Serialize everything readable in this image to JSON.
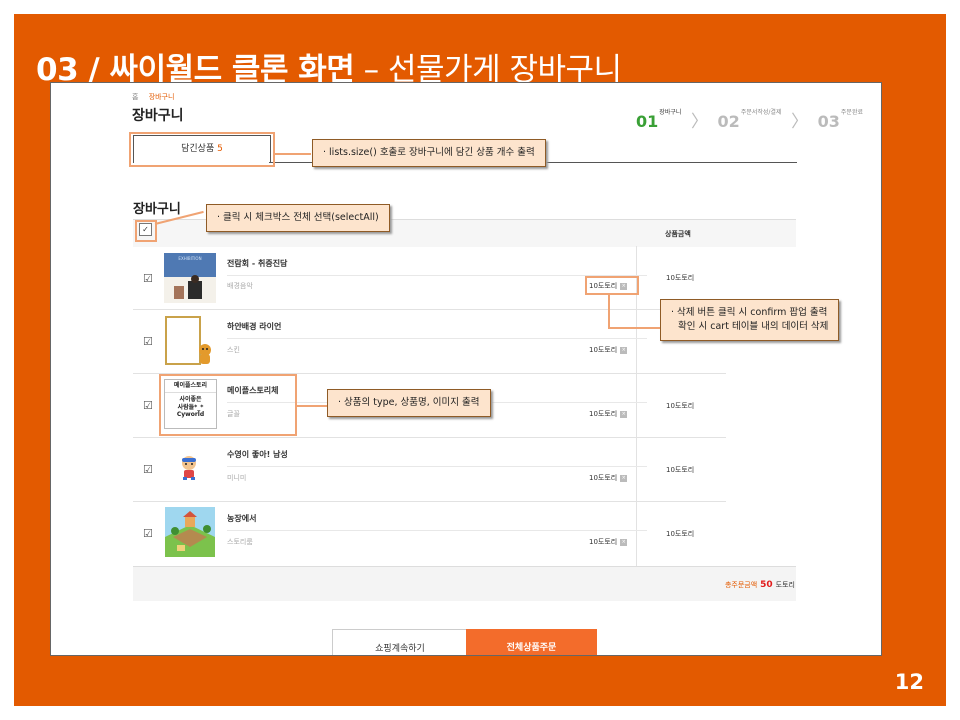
{
  "slide": {
    "title_bold": "03 / 싸이월드 클론 화면",
    "title_light": " – 선물가게 장바구니",
    "page_number": "12"
  },
  "shop": {
    "breadcrumb": {
      "home": "홈",
      "current": "장바구니"
    },
    "page_title": "장바구니",
    "steps": [
      {
        "num": "01",
        "label": "장바구니",
        "active": true
      },
      {
        "num": "02",
        "label": "주문서작성/결제",
        "active": false
      },
      {
        "num": "03",
        "label": "주문완료",
        "active": false
      }
    ],
    "tab": {
      "label": "담긴상품",
      "count": "5"
    },
    "section_title": "장바구니",
    "table_header": {
      "price": "상품금액"
    },
    "items": [
      {
        "name": "전람회 - 취중진담",
        "type": "배경음악",
        "price": "10도토리",
        "col_price": "10도토리",
        "image": "album-cover"
      },
      {
        "name": "하얀배경 라이언",
        "type": "스킨",
        "price": "10도토리",
        "col_price": "",
        "image": "skin-frame"
      },
      {
        "name": "메이플스토리체",
        "type": "글꼴",
        "price": "10도토리",
        "col_price": "10도토리",
        "image": "font-sample"
      },
      {
        "name": "수영이 좋아! 남성",
        "type": "미니미",
        "price": "10도토리",
        "col_price": "10도토리",
        "image": "minime-character"
      },
      {
        "name": "농장에서",
        "type": "스토리룸",
        "price": "10도토리",
        "col_price": "10도토리",
        "image": "story-room"
      }
    ],
    "font_sample": {
      "title": "메이플스토리",
      "line1": "사이좋은",
      "line2": "사람들*_*",
      "line3": "Cyworld"
    },
    "album_text": "EXHIBITION",
    "total": {
      "label": "총주문금액",
      "value": "50",
      "unit": "도토리"
    },
    "buttons": {
      "continue": "쇼핑계속하기",
      "order": "전체상품주문"
    }
  },
  "notes": {
    "count": "· lists.size() 호출로 장바구니에 담긴 상품 개수 출력",
    "select_all": "· 클릭 시 체크박스 전체 선택(selectAll)",
    "delete_line1": "· 삭제 버튼 클릭 시 confirm 팝업 출력",
    "delete_line2": "확인 시 cart 테이블 내의 데이터 삭제",
    "item_info": "· 상품의 type, 상품명, 이미지 출력"
  },
  "colors": {
    "slide_bg": "#e35a00",
    "accent": "#f36c2b",
    "step_active": "#3aa036",
    "note_bg": "#fde4cd",
    "highlight": "#f0a373"
  }
}
